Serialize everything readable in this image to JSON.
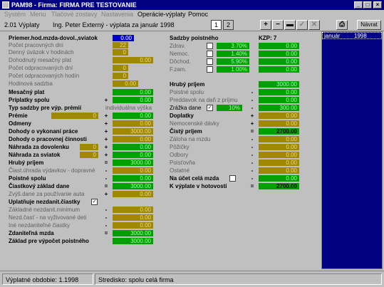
{
  "window": {
    "title": "PAM98 - Firma: FIRMA PRE TESTOVANIE"
  },
  "menu": [
    "Systém",
    "Menu",
    "Tlačové zostavy",
    "Nastavenia",
    "Operácie-výplaty",
    "Pomoc"
  ],
  "toolbar": {
    "module": "2.01  Výplaty",
    "employee": "Ing. Peter Externý - výplata za január 1998",
    "page1": "1",
    "page2": "2",
    "back": "Návrat"
  },
  "right": {
    "month": "január",
    "year": "1998"
  },
  "left": {
    "r1": {
      "label": "Priemer.hod.mzda-dovol.,sviatok",
      "value": "0.00"
    },
    "r2": {
      "label": "Počet pracovných dní",
      "value": "22"
    },
    "r3": {
      "label": "Denný úväzok v hodinách",
      "value": "0"
    },
    "r4": {
      "label": "Dohodnutý mesačný plat",
      "value": "0.00"
    },
    "r5": {
      "label": "Počet odpracovaných dní",
      "value": "0"
    },
    "r6": {
      "label": "Počet odpracovaných hodín",
      "value": "0"
    },
    "r7": {
      "label": "Hodinová sadzba",
      "value": "0.00"
    },
    "r8": {
      "label": "Mesačný plat",
      "value": "0.00"
    },
    "r9": {
      "label": "Príplatky spolu",
      "sign": "+",
      "value": "0.00"
    },
    "r10": {
      "label": "Typ sadzby pre výp. prémií",
      "value": "individuálna výška"
    },
    "r11": {
      "label": "Prémie",
      "pct": "0",
      "sign": "+",
      "value": "0.00"
    },
    "r12": {
      "label": "Odmeny",
      "sign": "+",
      "value": "0.00"
    },
    "r13": {
      "label": "Dohody o vykonaní práce",
      "sign": "+",
      "value": "3000.00"
    },
    "r14": {
      "label": "Dohody o pracovnej činnosti",
      "sign": "+",
      "value": "0.00"
    },
    "r15": {
      "label": "Náhrada za dovolenku",
      "pct": "0",
      "sign": "+",
      "value": "0.00"
    },
    "r16": {
      "label": "Náhrada za sviatok",
      "pct": "0",
      "sign": "+",
      "value": "0.00"
    },
    "r17": {
      "label": "Hrubý príjem",
      "sign": "=",
      "value": "3000.00"
    },
    "r18": {
      "label": "Čiast.úhrada výdavkov - dopravné",
      "sign": "-",
      "value": "0.00"
    },
    "r19": {
      "label": "Poistné spolu",
      "sign": "-",
      "value": "0.00"
    },
    "r20": {
      "label": "Čiastkový základ dane",
      "sign": "=",
      "value": "3000.00"
    },
    "r21": {
      "label": "Zvýš.dane za používanie auta",
      "sign": "+",
      "value": "0.00"
    },
    "r22": {
      "label": "Uplatňuje nezdanit.čiastky"
    },
    "r23": {
      "label": "Základné nezdanit.minimum",
      "sign": "-",
      "value": "0.00"
    },
    "r24": {
      "label": "Nezd.časť - na vyživované deti",
      "sign": "-",
      "value": "0.00"
    },
    "r25": {
      "label": "Iné nezdaniteľné čiastky",
      "sign": "-",
      "value": "0.00"
    },
    "r26": {
      "label": "Zdaniteľná mzda",
      "sign": "=",
      "value": "3000.00"
    },
    "r27": {
      "label": "Základ pre výpočet poistného",
      "value": "3000.00"
    }
  },
  "mid": {
    "title": "Sadzby poistného",
    "kzp": "KZP: 7",
    "ins": [
      {
        "label": "Zdrav.",
        "rate": "3.70%",
        "value": "0.00"
      },
      {
        "label": "Nemoc.",
        "rate": "1.40%",
        "value": "0.00"
      },
      {
        "label": "Dôchod.",
        "rate": "5.90%",
        "value": "0.00"
      },
      {
        "label": "F.zam.",
        "rate": "1.00%",
        "value": "0.00"
      }
    ],
    "m1": {
      "label": "Hrubý príjem",
      "value": "3000.00"
    },
    "m2": {
      "label": "Poistné spolu",
      "sign": "-",
      "value": "0.00"
    },
    "m3": {
      "label": "Preddavok na daň z príjmu",
      "sign": "-",
      "value": "0.00"
    },
    "m4": {
      "label": "Zrážka dane",
      "pct": "10%",
      "sign": "-",
      "value": "300.00"
    },
    "m5": {
      "label": "Doplatky",
      "sign": "+",
      "value": "0.00"
    },
    "m6": {
      "label": "Nemocenské dávky",
      "sign": "+",
      "value": "0.00"
    },
    "m7": {
      "label": "Čistý príjem",
      "sign": "=",
      "value": "2700.00"
    },
    "m8": {
      "label": "Záloha na mzdu",
      "sign": "-",
      "value": "0.00"
    },
    "m9": {
      "label": "Pôžičky",
      "sign": "-",
      "value": "0.00"
    },
    "m10": {
      "label": "Odbory",
      "sign": "-",
      "value": "0.00"
    },
    "m11": {
      "label": "Poisťovňa",
      "sign": "-",
      "value": "0.00"
    },
    "m12": {
      "label": "Ostatné",
      "sign": "-",
      "value": "0.00"
    },
    "m13": {
      "label": "Na účet celá mzda",
      "sign": "-",
      "value": "0.00"
    },
    "m14": {
      "label": "K výplate v hotovosti",
      "sign": "=",
      "value": "2700.00"
    }
  },
  "status": {
    "period": "Výplatné obdobie: 1.1998",
    "center": "Stredisko: spolu celá firma"
  }
}
